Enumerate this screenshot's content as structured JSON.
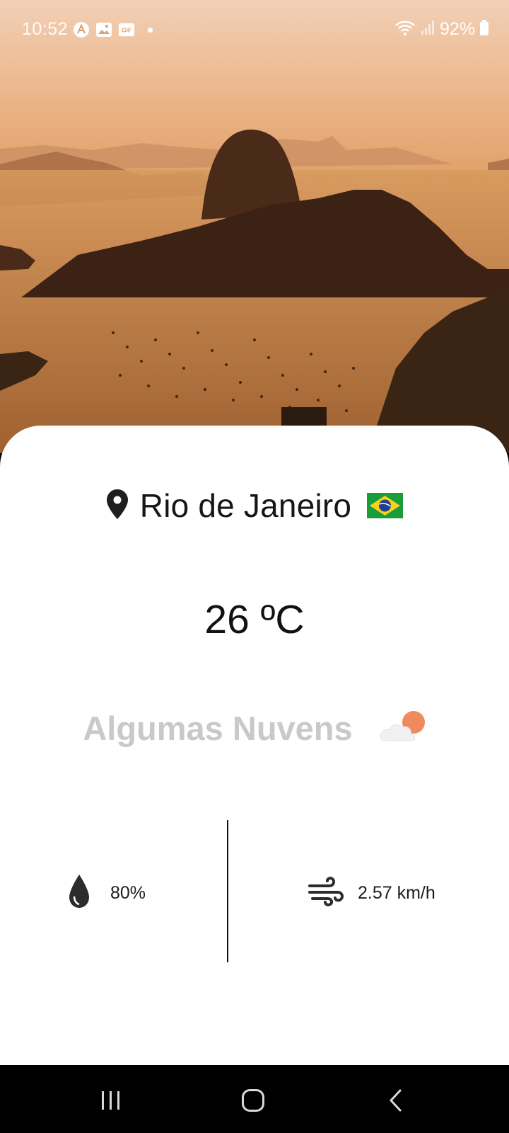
{
  "status_bar": {
    "time": "10:52",
    "battery_text": "92%",
    "notification_icons": [
      "app-a-icon",
      "gallery-icon",
      "gif-icon",
      "dot-indicator"
    ]
  },
  "location": {
    "city": "Rio de Janeiro",
    "country_flag": "brazil-flag-icon"
  },
  "weather": {
    "temperature": "26 ºC",
    "condition": "Algumas Nuvens",
    "condition_icon": "partly-cloudy-sun-icon",
    "humidity": "80%",
    "wind": "2.57 km/h"
  },
  "colors": {
    "card_background": "#ffffff",
    "condition_text": "#c9c9c9",
    "sun_accent": "#f08a5d",
    "sky_top": "#f2c4a7",
    "sky_bottom": "#d98e47"
  }
}
